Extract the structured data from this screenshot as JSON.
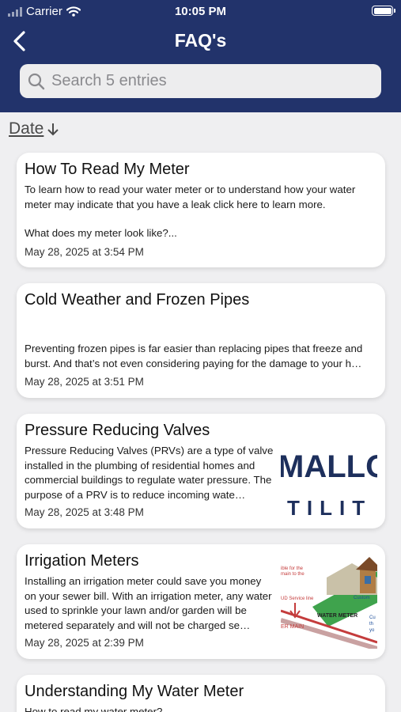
{
  "status_bar": {
    "carrier": "Carrier",
    "time": "10:05 PM"
  },
  "nav": {
    "title": "FAQ's"
  },
  "search": {
    "placeholder": "Search 5 entries"
  },
  "sort": {
    "label": "Date"
  },
  "entries": [
    {
      "title": "How To Read My Meter",
      "body": "To learn how to read your water meter or to understand how your water meter may indicate that you have a leak click here to learn more.",
      "body_extra": "What does my meter look like?...",
      "date": "May 28, 2025 at 3:54 PM"
    },
    {
      "title": "Cold Weather and Frozen Pipes",
      "body": "Preventing frozen pipes is far easier than replacing pipes that freeze and burst. And that’s not even considering paying for the damage to your h…",
      "date": "May 28, 2025 at 3:51 PM"
    },
    {
      "title": "Pressure Reducing Valves",
      "body": "Pressure Reducing Valves (PRVs) are a type of valve installed in the plumbing of residential homes and commercial buildings to regulate water pressure. The purpose of a PRV is to reduce incoming wate…",
      "date": "May 28, 2025 at 3:48 PM",
      "image_text": [
        "MALLO",
        "TILIT"
      ]
    },
    {
      "title": "Irrigation Meters",
      "body": "Installing an irrigation meter could save you money on your sewer bill. With an irrigation meter, any water used to sprinkle your lawn and/or garden will be metered separately and will not be charged se…",
      "date": "May 28, 2025 at 2:39 PM",
      "image_text": [
        "ible for the",
        "main to the",
        "UD Service line",
        "WATER METER",
        "Custom",
        "Cu",
        "th",
        "yo",
        "ER MAIN"
      ]
    },
    {
      "title": "Understanding My Water Meter",
      "body": "How to read my water meter?"
    }
  ]
}
